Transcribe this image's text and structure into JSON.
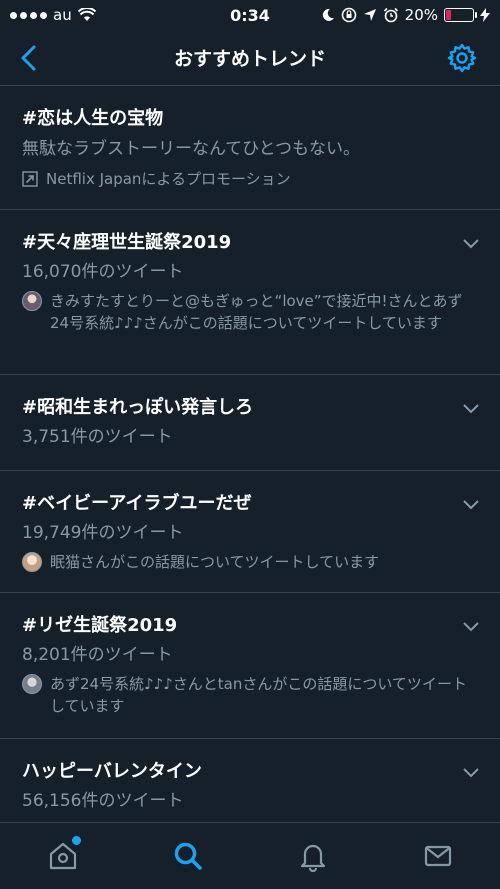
{
  "status_bar": {
    "carrier": "au",
    "time": "0:34",
    "battery_percent": "20%",
    "battery_level": 0.2
  },
  "header": {
    "title": "おすすめトレンド"
  },
  "trends": [
    {
      "name": "#恋は人生の宝物",
      "description": "無駄なラブストーリーなんてひとつもない。",
      "promo": "Netflix Japanによるプロモーション"
    },
    {
      "name": "#天々座理世生誕祭2019",
      "count": "16,070件のツイート",
      "context": "きみすたすとりーと@もぎゅっと“love”で接近中!さんとあず24号系統♪♪♪さんがこの話題についてツイートしています"
    },
    {
      "name": "#昭和生まれっぽい発言しろ",
      "count": "3,751件のツイート"
    },
    {
      "name": "#ベイビーアイラブユーだぜ",
      "count": "19,749件のツイート",
      "context": "眠猫さんがこの話題についてツイートしています"
    },
    {
      "name": "#リゼ生誕祭2019",
      "count": "8,201件のツイート",
      "context": "あず24号系統♪♪♪さんとtanさんがこの話題についてツイートしています"
    },
    {
      "name": "ハッピーバレンタイン",
      "count": "56,156件のツイート"
    }
  ],
  "colors": {
    "background": "#15202b",
    "accent": "#1da1f2",
    "secondary_text": "#8899a6",
    "divider": "#38444d"
  },
  "icons": {
    "back": "chevron-left-icon",
    "settings": "gear-icon",
    "home": "home-icon",
    "search": "search-icon",
    "notifications": "bell-icon",
    "messages": "mail-icon"
  }
}
